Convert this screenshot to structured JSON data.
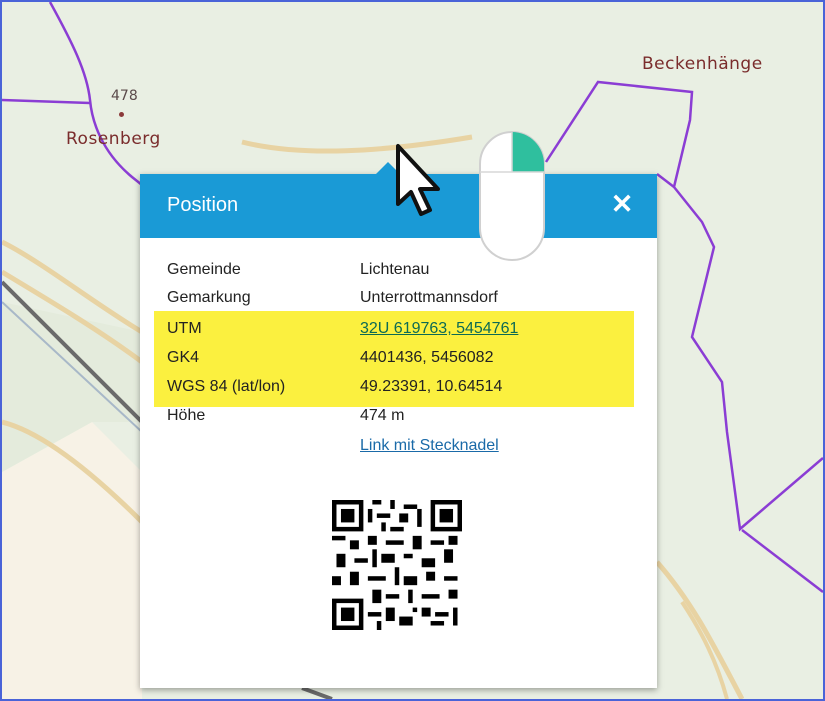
{
  "map": {
    "places": [
      {
        "name": "Rosenberg"
      },
      {
        "name": "Beckenhänge"
      }
    ],
    "elevation_label": "478"
  },
  "popup": {
    "title": "Position",
    "close_icon": "close-icon",
    "rows": [
      {
        "label": "Gemeinde",
        "value": "Lichtenau"
      },
      {
        "label": "Gemarkung",
        "value": "Unterrottmannsdorf"
      },
      {
        "label": "UTM",
        "value": "32U 619763, 5454761",
        "highlighted": true,
        "is_link": true
      },
      {
        "label": "GK4",
        "value": "4401436, 5456082",
        "highlighted": true
      },
      {
        "label": "WGS 84 (lat/lon)",
        "value": "49.23391, 10.64514",
        "highlighted": true
      },
      {
        "label": "Höhe",
        "value": "474 m"
      }
    ],
    "pin_link": "Link mit Stecknadel",
    "qr_icon": "qr-code-icon"
  },
  "colors": {
    "header": "#1a9ad6",
    "highlight": "#fbf03f",
    "boundary": "#8b3dd4",
    "road": "#e8d3a3"
  }
}
